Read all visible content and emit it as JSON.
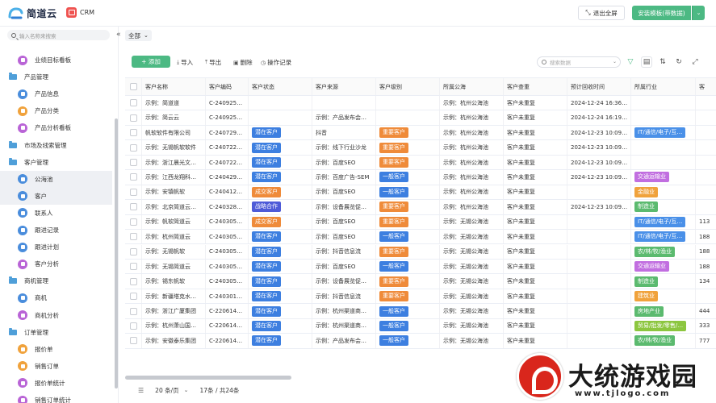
{
  "header": {
    "logo_text": "简道云",
    "app_name": "CRM",
    "exit_fullscreen": "退出全屏",
    "install_template": "安装模板(带数据)"
  },
  "sidebar": {
    "search_placeholder": "输入名称来搜索",
    "collapse_glyph": "«",
    "items": [
      {
        "type": "child",
        "label": "业绩目标看板",
        "color": "#b964d6"
      },
      {
        "type": "group",
        "label": "产品管理"
      },
      {
        "type": "child",
        "label": "产品信息",
        "color": "#4a8ddc"
      },
      {
        "type": "child",
        "label": "产品分类",
        "color": "#f0a23c"
      },
      {
        "type": "child",
        "label": "产品分析看板",
        "color": "#b964d6"
      },
      {
        "type": "group",
        "label": "市场及线索管理"
      },
      {
        "type": "group",
        "label": "客户管理"
      },
      {
        "type": "child",
        "label": "公海池",
        "color": "#4a8ddc",
        "active": true
      },
      {
        "type": "child",
        "label": "客户",
        "color": "#4a8ddc",
        "active": true
      },
      {
        "type": "child",
        "label": "联系人",
        "color": "#4a8ddc"
      },
      {
        "type": "child",
        "label": "跟进记录",
        "color": "#4a8ddc"
      },
      {
        "type": "child",
        "label": "跟进计划",
        "color": "#4a8ddc"
      },
      {
        "type": "child",
        "label": "客户分析",
        "color": "#b964d6"
      },
      {
        "type": "group",
        "label": "商机管理"
      },
      {
        "type": "child",
        "label": "商机",
        "color": "#4a8ddc"
      },
      {
        "type": "child",
        "label": "商机分析",
        "color": "#b964d6"
      },
      {
        "type": "group",
        "label": "订单管理"
      },
      {
        "type": "child",
        "label": "报价单",
        "color": "#f0a23c"
      },
      {
        "type": "child",
        "label": "销售订单",
        "color": "#f0a23c"
      },
      {
        "type": "child",
        "label": "报价单统计",
        "color": "#b964d6"
      },
      {
        "type": "child",
        "label": "销售订单统计",
        "color": "#b964d6"
      }
    ]
  },
  "filter": {
    "label": "全部",
    "chevron": "⌄"
  },
  "toolbar": {
    "add": "+ 添加",
    "import": "导入",
    "export": "导出",
    "delete": "删除",
    "log": "操作记录",
    "search_placeholder": "搜索数据"
  },
  "colors": {
    "accent": "#4cb983",
    "blue": "#3d7fe0",
    "orange": "#ef8b3a",
    "purple": "#4e5bd8",
    "industry_blue": "#4a90e8",
    "industry_purple": "#c16ee0",
    "industry_orange": "#f0a23c",
    "industry_green": "#5bba6f",
    "industry_lime": "#8cc63f"
  },
  "table": {
    "columns": [
      "客户名称",
      "客户编码",
      "客户状态",
      "客户来源",
      "客户级别",
      "所属公海",
      "客户查重",
      "预计回收时间",
      "所属行业",
      "客"
    ],
    "rows": [
      [
        "示例：简道道",
        "C-240925…",
        "",
        "",
        "",
        "示例：杭州公海池",
        "客户未重复",
        "2024-12-24 16:36…",
        "",
        ""
      ],
      [
        "示例：简云云",
        "C-240925…",
        "",
        "示例：产品发布会…",
        "",
        "示例：杭州公海池",
        "客户未重复",
        "2024-12-24 16:19…",
        "",
        ""
      ],
      [
        "帆软软件有限公司",
        "C-240729…",
        "潜在客户",
        "抖音",
        "重要客户",
        "示例：杭州公海池",
        "客户未重复",
        "2024-12-23 10:09…",
        "IT/通信/电子/互…",
        ""
      ],
      [
        "示例：无锡帆软软件",
        "C-240722…",
        "潜在客户",
        "示例：线下行业沙龙",
        "重要客户",
        "示例：杭州公海池",
        "客户未重复",
        "2024-12-23 10:09…",
        "",
        ""
      ],
      [
        "示例：浙江晨光文…",
        "C-240722…",
        "潜在客户",
        "示例：百度SEO",
        "重要客户",
        "示例：杭州公海池",
        "客户未重复",
        "2024-12-23 10:09…",
        "",
        ""
      ],
      [
        "示例：江西龙翔科…",
        "C-240429…",
        "潜在客户",
        "示例：百度广告-SEM",
        "一般客户",
        "示例：杭州公海池",
        "客户未重复",
        "2024-12-23 10:09…",
        "交通运输业",
        ""
      ],
      [
        "示例：安镇帆软",
        "C-240412…",
        "成交客户",
        "示例：百度SEO",
        "一般客户",
        "示例：杭州公海池",
        "客户未重复",
        "",
        "金融业",
        ""
      ],
      [
        "示例：北京简道云…",
        "C-240328…",
        "战略合作",
        "示例：设备展览促…",
        "重要客户",
        "示例：杭州公海池",
        "客户未重复",
        "2024-12-23 10:09…",
        "制造业",
        ""
      ],
      [
        "示例：帆软简道云",
        "C-240305…",
        "成交客户",
        "示例：百度SEO",
        "重要客户",
        "示例：无锡公海池",
        "客户未重复",
        "",
        "IT/通信/电子/互…",
        "113"
      ],
      [
        "示例：杭州简道云",
        "C-240305…",
        "潜在客户",
        "示例：百度SEO",
        "一般客户",
        "示例：无锡公海池",
        "客户未重复",
        "",
        "IT/通信/电子/互…",
        "188"
      ],
      [
        "示例：无锡帆软",
        "C-240305…",
        "潜在客户",
        "示例：抖音信息流",
        "重要客户",
        "示例：无锡公海池",
        "客户未重复",
        "",
        "农/林/牧/渔业",
        "188"
      ],
      [
        "示例：无锡简道云",
        "C-240305…",
        "潜在客户",
        "示例：百度SEO",
        "一般客户",
        "示例：无锡公海池",
        "客户未重复",
        "",
        "交通运输业",
        "188"
      ],
      [
        "示例：锡东帆软",
        "C-240305…",
        "潜在客户",
        "示例：设备展览促…",
        "重要客户",
        "示例：无锡公海池",
        "客户未重复",
        "",
        "制造业",
        "134"
      ],
      [
        "示例：新疆塔克水…",
        "C-240301…",
        "潜在客户",
        "示例：抖音信息流",
        "重要客户",
        "示例：无锡公海池",
        "客户未重复",
        "",
        "建筑业",
        ""
      ],
      [
        "示例：浙江广厦集团",
        "C-220614…",
        "潜在客户",
        "示例：杭州渠道商…",
        "一般客户",
        "示例：无锡公海池",
        "客户未重复",
        "",
        "房地产业",
        "444"
      ],
      [
        "示例：杭州萧山国…",
        "C-220614…",
        "潜在客户",
        "示例：杭州渠道商…",
        "一般客户",
        "示例：无锡公海池",
        "客户未重复",
        "",
        "贸易/批发/零售/…",
        "333"
      ],
      [
        "示例：安徽泰乐集团",
        "C-220614…",
        "潜在客户",
        "示例：产品发布会…",
        "一般客户",
        "示例：无锡公海池",
        "客户未重复",
        "",
        "农/林/牧/渔业",
        "777"
      ]
    ]
  },
  "pager": {
    "page_size": "20 条/页",
    "summary": "17条 / 共24条"
  },
  "watermark": {
    "title": "大统游戏园",
    "url": "www.tjlogo.com"
  }
}
